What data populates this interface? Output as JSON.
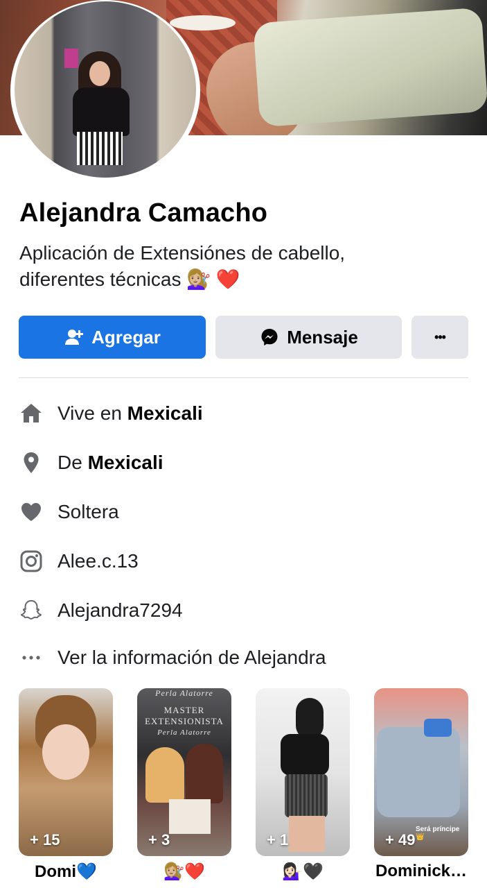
{
  "profile": {
    "name": "Alejandra Camacho",
    "bio_line1": "Aplicación de Extensiónes de cabello,",
    "bio_line2": "diferentes técnicas",
    "bio_emoji_hair": "💇🏼‍♀️",
    "bio_emoji_heart": "❤️"
  },
  "actions": {
    "add_label": "Agregar",
    "message_label": "Mensaje",
    "more_label": "•••"
  },
  "info": {
    "lives_prefix": "Vive en",
    "lives_city": "Mexicali",
    "from_prefix": "De",
    "from_city": "Mexicali",
    "relationship": "Soltera",
    "instagram": "Alee.c.13",
    "snapchat": "Alejandra7294",
    "see_more": "Ver la información de Alejandra"
  },
  "highlights": [
    {
      "count": "+ 15",
      "label": "Domi💙"
    },
    {
      "count": "+ 3",
      "label": "💇🏼‍♀️❤️",
      "card_text_1": "Perla Alatorre",
      "card_text_2": "MASTER",
      "card_text_3": "EXTENSIONISTA",
      "card_text_4": "Perla Alatorre"
    },
    {
      "count": "+ 1",
      "label": "💁🏻‍♀️🖤"
    },
    {
      "count": "+ 49",
      "label": "Dominick…",
      "card_text_1": "Será príncipe 👑"
    }
  ],
  "icons": [
    "person-add-icon",
    "messenger-icon",
    "more-icon",
    "home-icon",
    "location-pin-icon",
    "heart-icon",
    "instagram-icon",
    "snapchat-icon",
    "ellipsis-icon"
  ],
  "colors": {
    "primary": "#1b74e4",
    "secondary_button": "#e4e6eb",
    "icon_gray": "#65676b"
  }
}
